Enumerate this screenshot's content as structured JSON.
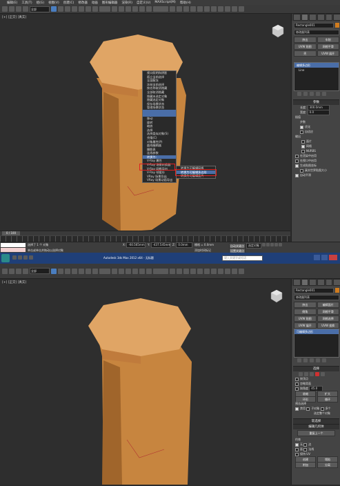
{
  "top": {
    "menu": [
      "编辑(E)",
      "工具(T)",
      "组(G)",
      "视图(V)",
      "创建(C)",
      "修改器",
      "动画",
      "图形编辑器",
      "渲染(R)",
      "自定义(U)",
      "MAXScript(M)",
      "帮助(H)"
    ],
    "toolbar_select_value": "全部",
    "viewport_label": "[+] [正交] [真实]",
    "command_panel": {
      "object_name": "Rectangle001",
      "modifier_list": "修改器列表",
      "buttons": [
        "挤出",
        "车削",
        "UVW 贴图",
        "网格平滑",
        "壳",
        "UVW 展开"
      ],
      "stack_items": [
        "编辑多边形",
        "Line"
      ],
      "params_title": "参数",
      "length_label": "长度:",
      "length_value": "300.0mm",
      "width_label": "宽度:",
      "width_value": "0.0",
      "corner_label": "角半径:",
      "interp_title": "插值",
      "step_label": "步数",
      "optimize_label": "优化",
      "adaptive_label": "自适应",
      "output_title": "输出",
      "patch_label": "面片",
      "mesh_label": "网格",
      "nurbs_label": "NURBS",
      "render_title": "渲染",
      "render_opts": [
        "在渲染中启用",
        "在视口中启用",
        "生成贴图坐标",
        "真实世界贴图大小"
      ],
      "auto_smooth": "自动平滑"
    },
    "context_menu": {
      "items": [
        "视口照明和阴影",
        "孤立当前选择",
        "全部解冻",
        "冻结当前选择",
        "按名称取消隐藏",
        "全部取消隐藏",
        "隐藏未选定对象",
        "隐藏选定对象",
        "保存场景状态",
        "管理场景状态",
        "",
        "移动",
        "旋转",
        "缩放",
        "选择",
        "选择类似对象(S)",
        "克隆(C)",
        "对象属性(P)",
        "曲线编辑器",
        "摄影表",
        "连线参数",
        "转换为:",
        "V-Ray 属性",
        "V-Ray 场景转换器",
        "V-Ray 网格导出",
        "V-Ray 帧缓存",
        "VRay 场景导出",
        "VRay 场景动画导出"
      ],
      "highlight_index": 21,
      "submenu_items": [
        "转换为可编辑网格",
        "转换为可编辑多边形",
        "转换为可编辑面片"
      ],
      "submenu_highlight": 1
    },
    "timeline_value": "0 / 100",
    "status": {
      "selected_text": "选择了 1 个 对象",
      "hint_text": "单击或单击并拖动以选择对象",
      "x_label": "X:",
      "x_value": "-60.565mm",
      "y_label": "Y:",
      "y_value": "-437.545mm",
      "z_label": "Z:",
      "z_value": "0.0mm",
      "grid_label": "栅格 = 0.0mm",
      "auto_key": "自动关键点",
      "set_key": "设置关键点",
      "selected_obj": "选定对象",
      "add_time_tag": "添加时间标记"
    }
  },
  "taskbar": {
    "title": "Autodesk 3ds Max 2012 x64 - 无标题",
    "search_placeholder": "键入关键字或短语"
  },
  "bottom": {
    "toolbar_select_value": "全部",
    "viewport_label": "[+] [正交] [真实]",
    "command_panel": {
      "object_name": "Rectangle001",
      "modifier_list": "修改器列表",
      "buttons": [
        "挤出",
        "编辑面片",
        "倒角",
        "网格平滑",
        "UVW 贴图",
        "网格选择",
        "UVW 展开",
        "UVW 变换"
      ],
      "stack_items": [
        "可编辑多边形"
      ],
      "select_title": "选择",
      "select_opts": [
        "按顶点",
        "忽略背面",
        "按角度"
      ],
      "angle_value": "45.0",
      "shrink": "收缩",
      "grow": "扩大",
      "ring": "环形",
      "loop": "循环",
      "preview_label": "预览选择",
      "preview_opts": [
        "禁用",
        "子对象",
        "多个"
      ],
      "whole_label": "选定整个对象",
      "soft_title": "软选择",
      "edit_geo_title": "编辑几何体",
      "repeat_last": "重复上一个",
      "constraints_label": "约束",
      "constraints_opts": [
        "无",
        "边",
        "面",
        "法线"
      ],
      "keep_uv": "保持 UV",
      "create": "创建",
      "collapse": "塌陷",
      "attach": "附加",
      "detach": "分离"
    }
  }
}
